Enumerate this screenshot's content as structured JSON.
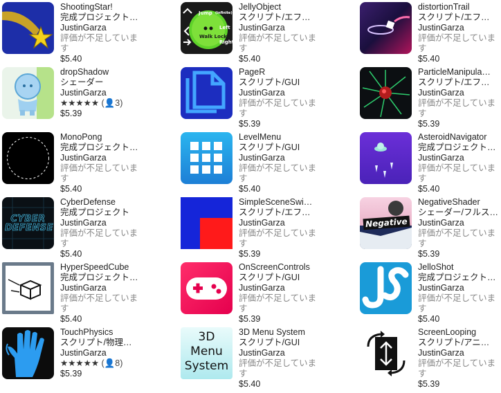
{
  "rating_placeholder": "評価が不足しています",
  "items": [
    {
      "title": "ShootingStar!",
      "category": "完成プロジェクト…",
      "publisher": "JustinGarza",
      "price": "$5.40"
    },
    {
      "title": "JellyObject",
      "category": "スクリプト/エフ…",
      "publisher": "JustinGarza",
      "price": "$5.40",
      "thumb_text": {
        "line1": "Jump",
        "line1b": "(infinite)",
        "line2": "Left",
        "line3": "Right",
        "line4": "Walk Lock",
        "line5": "Left",
        "line6": "Right"
      }
    },
    {
      "title": "distortionTrail",
      "category": "スクリプト/エフ…",
      "publisher": "JustinGarza",
      "price": "$5.40"
    },
    {
      "title": "dropShadow",
      "category": "シェーダー",
      "publisher": "JustinGarza",
      "stars": "★★★★★",
      "rating_count": "(👤3)",
      "price": "$5.39"
    },
    {
      "title": "PageR",
      "category": "スクリプト/GUI",
      "publisher": "JustinGarza",
      "price": "$5.39"
    },
    {
      "title": "ParticleManipula…",
      "category": "スクリプト/エフ…",
      "publisher": "JustinGarza",
      "price": "$5.39"
    },
    {
      "title": "MonoPong",
      "category": "完成プロジェクト…",
      "publisher": "JustinGarza",
      "price": "$5.40"
    },
    {
      "title": "LevelMenu",
      "category": "スクリプト/GUI",
      "publisher": "JustinGarza",
      "price": "$5.40"
    },
    {
      "title": "AsteroidNavigator",
      "category": "完成プロジェクト…",
      "publisher": "JustinGarza",
      "price": "$5.40"
    },
    {
      "title": "CyberDefense",
      "category": "完成プロジェクト",
      "publisher": "JustinGarza",
      "price": "$5.40",
      "thumb_text": "CYBER DEFENSE"
    },
    {
      "title": "SimpleSceneSwi…",
      "category": "スクリプト/エフ…",
      "publisher": "JustinGarza",
      "price": "$5.39"
    },
    {
      "title": "NegativeShader",
      "category": "シェーダー/フルス…",
      "publisher": "JustinGarza",
      "price": "$5.39",
      "thumb_text": "Negative"
    },
    {
      "title": "HyperSpeedCube",
      "category": "完成プロジェクト…",
      "publisher": "JustinGarza",
      "price": "$5.40"
    },
    {
      "title": "OnScreenControls",
      "category": "スクリプト/GUI",
      "publisher": "JustinGarza",
      "price": "$5.39"
    },
    {
      "title": "JelloShot",
      "category": "完成プロジェクト…",
      "publisher": "JustinGarza",
      "price": "$5.40"
    },
    {
      "title": "TouchPhysics",
      "category": "スクリプト/物理…",
      "publisher": "JustinGarza",
      "stars": "★★★★★",
      "rating_count": "(👤8)",
      "price": "$5.39"
    },
    {
      "title": "3D Menu System",
      "category": "スクリプト/GUI",
      "publisher": "JustinGarza",
      "price": "$5.40",
      "thumb_text": {
        "line1": "3D",
        "line2": "Menu",
        "line3": "System"
      }
    },
    {
      "title": "ScreenLooping",
      "category": "スクリプト/アニ…",
      "publisher": "JustinGarza",
      "price": "$5.39"
    }
  ]
}
